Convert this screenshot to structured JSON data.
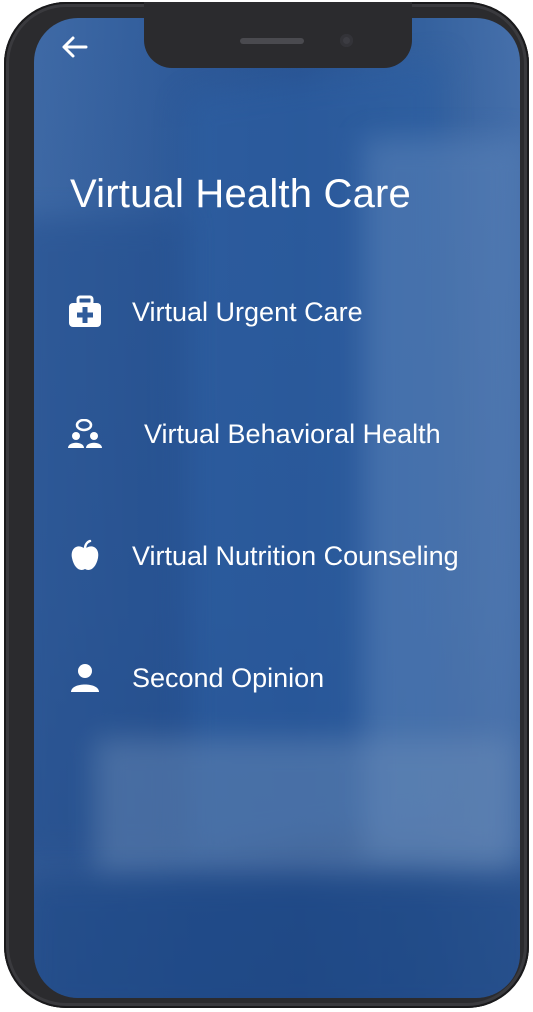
{
  "header": {
    "back_icon": "arrow-left-icon",
    "title": "Virtual Health Care"
  },
  "menu": {
    "items": [
      {
        "label": "Virtual Urgent Care",
        "icon": "medical-kit-icon"
      },
      {
        "label": "Virtual Behavioral Health",
        "icon": "group-chat-icon"
      },
      {
        "label": "Virtual Nutrition Counseling",
        "icon": "apple-icon"
      },
      {
        "label": "Second Opinion",
        "icon": "person-icon"
      }
    ]
  },
  "colors": {
    "screen_background": "#2f5b9a",
    "text": "#ffffff",
    "phone_frame": "#2b2b2e"
  }
}
